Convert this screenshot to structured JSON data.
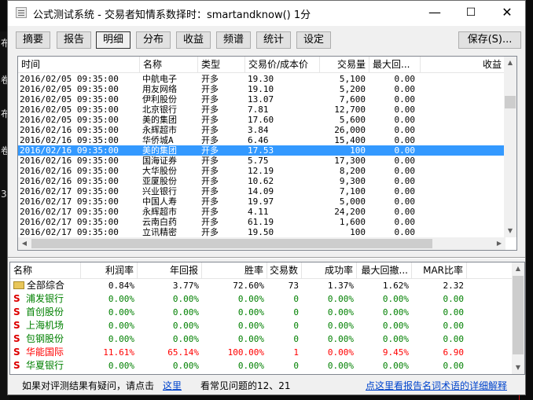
{
  "window": {
    "title": "公式测试系统 - 交易者知情系数择时：smartandknow() 1分",
    "minimize": "—",
    "maximize": "☐",
    "close": "✕"
  },
  "toolbar": {
    "tabs": [
      "摘要",
      "报告",
      "明细",
      "分布",
      "收益",
      "频谱",
      "统计",
      "设定"
    ],
    "active_tab": "明细",
    "save_label": "保存(S)..."
  },
  "background": {
    "left_labels": [
      "布",
      "卷",
      "布",
      "卷",
      "3"
    ]
  },
  "trades": {
    "columns": [
      "时间",
      "名称",
      "类型",
      "交易价/成本价",
      "交易量",
      "最大回...",
      "收益"
    ],
    "rows": [
      [
        "2016/02/05 09:35:00",
        "中航电子",
        "开多",
        "19.30",
        "5,100",
        "0.00"
      ],
      [
        "2016/02/05 09:35:00",
        "用友网络",
        "开多",
        "19.10",
        "5,200",
        "0.00"
      ],
      [
        "2016/02/05 09:35:00",
        "伊利股份",
        "开多",
        "13.07",
        "7,600",
        "0.00"
      ],
      [
        "2016/02/05 09:35:00",
        "北京银行",
        "开多",
        "7.81",
        "12,700",
        "0.00"
      ],
      [
        "2016/02/05 09:35:00",
        "美的集团",
        "开多",
        "17.60",
        "5,600",
        "0.00"
      ],
      [
        "2016/02/16 09:35:00",
        "永辉超市",
        "开多",
        "3.84",
        "26,000",
        "0.00"
      ],
      [
        "2016/02/16 09:35:00",
        "华侨城A",
        "开多",
        "6.46",
        "15,400",
        "0.00"
      ],
      [
        "2016/02/16 09:35:00",
        "美的集团",
        "开多",
        "17.53",
        "100",
        "0.00"
      ],
      [
        "2016/02/16 09:35:00",
        "国海证券",
        "开多",
        "5.75",
        "17,300",
        "0.00"
      ],
      [
        "2016/02/16 09:35:00",
        "大华股份",
        "开多",
        "12.19",
        "8,200",
        "0.00"
      ],
      [
        "2016/02/16 09:35:00",
        "亚厦股份",
        "开多",
        "10.62",
        "9,300",
        "0.00"
      ],
      [
        "2016/02/17 09:35:00",
        "兴业银行",
        "开多",
        "14.09",
        "7,100",
        "0.00"
      ],
      [
        "2016/02/17 09:35:00",
        "中国人寿",
        "开多",
        "19.97",
        "5,000",
        "0.00"
      ],
      [
        "2016/02/17 09:35:00",
        "永辉超市",
        "开多",
        "4.11",
        "24,200",
        "0.00"
      ],
      [
        "2016/02/17 09:35:00",
        "云南白药",
        "开多",
        "61.19",
        "1,600",
        "0.00"
      ],
      [
        "2016/02/17 09:35:00",
        "立讯精密",
        "开多",
        "19.50",
        "100",
        "0.00"
      ]
    ],
    "selected_index": 7
  },
  "summary": {
    "columns": [
      "名称",
      "利润率",
      "年回报",
      "胜率",
      "交易数",
      "成功率",
      "最大回撤...",
      "MAR比率"
    ],
    "rows": [
      {
        "icon": "folder",
        "name": "全部综合",
        "values": [
          "0.84%",
          "3.77%",
          "72.60%",
          "73",
          "1.37%",
          "1.62%",
          "2.32"
        ],
        "color": "#000000",
        "name_color": "#000000"
      },
      {
        "icon": "S",
        "name": "浦发银行",
        "values": [
          "0.00%",
          "0.00%",
          "0.00%",
          "0",
          "0.00%",
          "0.00%",
          "0.00"
        ],
        "color": "#008000",
        "name_color": "#008000"
      },
      {
        "icon": "S",
        "name": "首创股份",
        "values": [
          "0.00%",
          "0.00%",
          "0.00%",
          "0",
          "0.00%",
          "0.00%",
          "0.00"
        ],
        "color": "#008000",
        "name_color": "#008000"
      },
      {
        "icon": "S",
        "name": "上海机场",
        "values": [
          "0.00%",
          "0.00%",
          "0.00%",
          "0",
          "0.00%",
          "0.00%",
          "0.00"
        ],
        "color": "#008000",
        "name_color": "#008000"
      },
      {
        "icon": "S",
        "name": "包钢股份",
        "values": [
          "0.00%",
          "0.00%",
          "0.00%",
          "0",
          "0.00%",
          "0.00%",
          "0.00"
        ],
        "color": "#008000",
        "name_color": "#008000"
      },
      {
        "icon": "S",
        "name": "华能国际",
        "values": [
          "11.61%",
          "65.14%",
          "100.00%",
          "1",
          "0.00%",
          "9.45%",
          "6.90"
        ],
        "color": "#ff0000",
        "name_color": "#ff0000"
      },
      {
        "icon": "S",
        "name": "华夏银行",
        "values": [
          "0.00%",
          "0.00%",
          "0.00%",
          "0",
          "0.00%",
          "0.00%",
          "0.00"
        ],
        "color": "#008000",
        "name_color": "#008000"
      }
    ]
  },
  "footer": {
    "question_text": "如果对评测结果有疑问，请点击",
    "link_here": "这里",
    "faq_text": "看常见问题的12、21",
    "glossary_link": "点这里看报告名词术语的详细解释"
  }
}
